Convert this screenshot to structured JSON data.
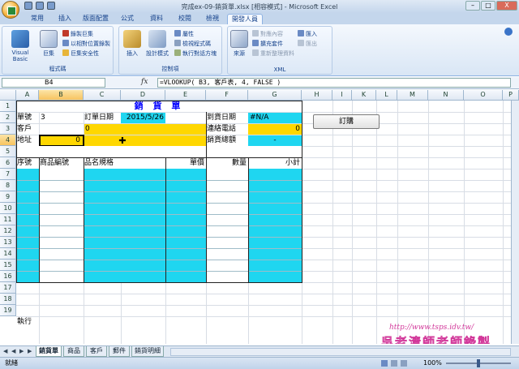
{
  "window": {
    "title": "完成ex-09-銷貨單.xlsx [相容模式] - Microsoft Excel",
    "controls": [
      "–",
      "□",
      "X"
    ]
  },
  "ribbon": {
    "tabs": [
      "常用",
      "插入",
      "版面配置",
      "公式",
      "資料",
      "校閱",
      "檢視",
      "開發人員"
    ],
    "active_tab": "開發人員",
    "groups": {
      "code": {
        "label": "程式碼",
        "visual_basic": "Visual Basic",
        "macros": "巨集",
        "record_macro": "錄製巨集",
        "relative_ref": "以相對位置錄製",
        "macro_security": "巨集安全性"
      },
      "controls": {
        "label": "控制項",
        "insert": "插入",
        "design_mode": "設計模式",
        "properties": "屬性",
        "view_code": "檢視程式碼",
        "run_dialog": "執行對話方塊"
      },
      "xml": {
        "label": "XML",
        "source": "來源",
        "map_properties": "對應內容",
        "expansion_packs": "擴充套件",
        "refresh_data": "重新整理資料",
        "import": "匯入",
        "export": "匯出"
      }
    }
  },
  "formula_bar": {
    "name_box": "B4",
    "fx": "fx",
    "formula": "=VLOOKUP( B3, 客戶表, 4, FALSE )"
  },
  "grid": {
    "columns": [
      "A",
      "B",
      "C",
      "D",
      "E",
      "F",
      "G",
      "H",
      "I",
      "K",
      "L",
      "M",
      "N",
      "O",
      "P"
    ],
    "selected_column": "B",
    "selected_row": "4",
    "rows": [
      "1",
      "2",
      "3",
      "4",
      "5",
      "6",
      "7",
      "8",
      "9",
      "10",
      "11",
      "12",
      "13",
      "14",
      "15",
      "16",
      "17",
      "18",
      "19"
    ],
    "cells": {
      "title": "銷 貨 單",
      "a2": "單號",
      "b2": "3",
      "c2": "訂單日期",
      "d2": "2015/5/26",
      "f2": "到貨日期",
      "g2": "#N/A",
      "a3": "客戶",
      "c3": "0",
      "f3": "連絡電話",
      "g3": "0",
      "a4": "地址",
      "b4": "0",
      "f4": "銷貨總額",
      "g4": "-",
      "a6": "序號",
      "b6": "商品編號",
      "c6": "品名規格",
      "e6": "單價",
      "f6": "數量",
      "g6": "小計",
      "a20": "執行"
    },
    "order_button": "訂購"
  },
  "sheet_tabs": [
    "銷貨單",
    "商品",
    "客戶",
    "郵件",
    "銷貨明細"
  ],
  "active_sheet": "銷貨單",
  "status": {
    "mode": "就緒",
    "zoom": "100%",
    "watermark_url": "http://www.tsps.idv.tw/",
    "watermark_signature": "吳老清師老師錄製"
  },
  "colors": {
    "cyan": "#1fd6f0",
    "yellow": "#ffd700",
    "ribbon_text": "#15428b",
    "title_blue": "#0000ff"
  }
}
